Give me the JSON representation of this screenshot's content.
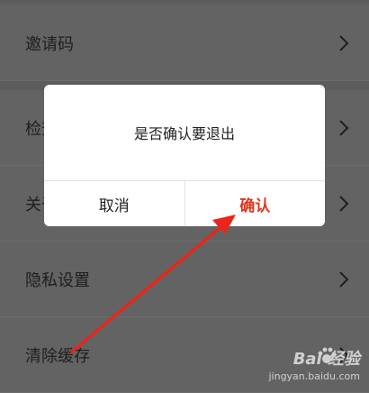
{
  "settings": {
    "items": [
      {
        "label": "邀请码"
      },
      {
        "label": "检查更新"
      },
      {
        "label": "关于我们"
      },
      {
        "label": "隐私设置"
      },
      {
        "label": "清除缓存"
      }
    ]
  },
  "dialog": {
    "message": "是否确认要退出",
    "cancel_label": "取消",
    "confirm_label": "确认"
  },
  "annotation": {
    "arrow_color": "#e8271a"
  },
  "watermark": {
    "brand": "Bai 经验",
    "url": "jingyan.baidu.com"
  }
}
